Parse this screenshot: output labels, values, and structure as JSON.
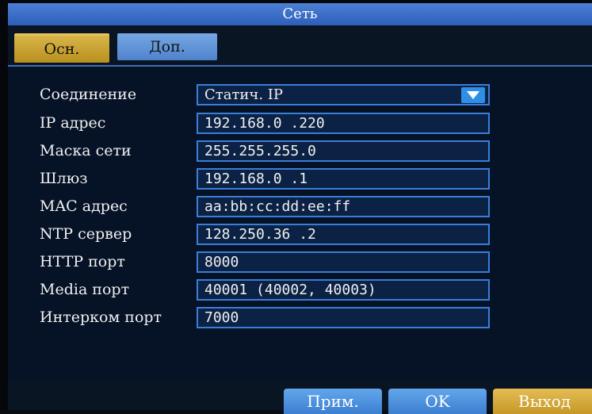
{
  "window": {
    "title": "Сеть"
  },
  "tabs": [
    {
      "label": "Осн.",
      "active": false
    },
    {
      "label": "Доп.",
      "active": true
    }
  ],
  "form": {
    "rows": [
      {
        "label": "Соединение",
        "value": "Статич. IP",
        "type": "select"
      },
      {
        "label": "IP адрес",
        "value": "192.168.0  .220",
        "type": "input"
      },
      {
        "label": "Маска сети",
        "value": "255.255.255.0",
        "type": "input"
      },
      {
        "label": "Шлюз",
        "value": "192.168.0  .1",
        "type": "input"
      },
      {
        "label": "MAC адрес",
        "value": "aa:bb:cc:dd:ee:ff",
        "type": "input"
      },
      {
        "label": "NTP сервер",
        "value": "128.250.36 .2",
        "type": "input"
      },
      {
        "label": "HTTP порт",
        "value": "8000",
        "type": "input"
      },
      {
        "label": "Media порт",
        "value": "40001 (40002, 40003)",
        "type": "input"
      },
      {
        "label": "Интерком порт",
        "value": "7000",
        "type": "input"
      }
    ]
  },
  "buttons": {
    "apply_label": "Прим.",
    "ok_label": "OK",
    "exit_label": "Выход"
  },
  "icons": {
    "dropdown": "chevron-down-icon"
  },
  "colors": {
    "title_bar": "#3f72c9",
    "active_tab": "#4f82cc",
    "inactive_tab": "#c9a232",
    "field_border": "#3b7dd8",
    "field_bg": "#0b2245",
    "exit_button": "#d4a83a",
    "dropdown_button": "#2f8fe6"
  }
}
